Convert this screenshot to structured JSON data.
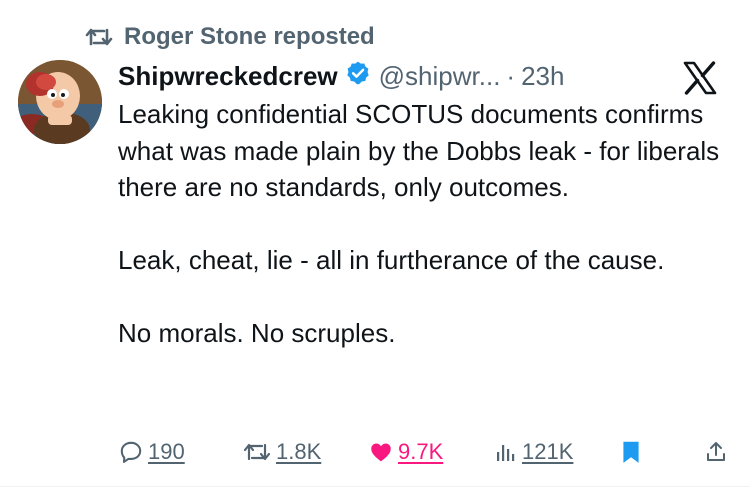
{
  "repost": {
    "icon": "repost-icon",
    "text": "Roger Stone reposted"
  },
  "author": {
    "avatar": "avatar",
    "display_name": "Shipwreckedcrew",
    "verified": true,
    "handle": "@shipwr...",
    "separator": "·",
    "time": "23h"
  },
  "body": {
    "paragraphs": [
      "Leaking confidential SCOTUS documents confirms what was made plain by the Dobbs leak - for liberals there are no standards, only outcomes.",
      "Leak, cheat, lie - all in furtherance of the cause.",
      "No morals.  No scruples."
    ]
  },
  "actions": {
    "replies": "190",
    "reposts": "1.8K",
    "likes": "9.7K",
    "views": "121K"
  },
  "colors": {
    "text": "#0f1419",
    "muted": "#536471",
    "like": "#f91880",
    "accent": "#1d9bf0"
  }
}
